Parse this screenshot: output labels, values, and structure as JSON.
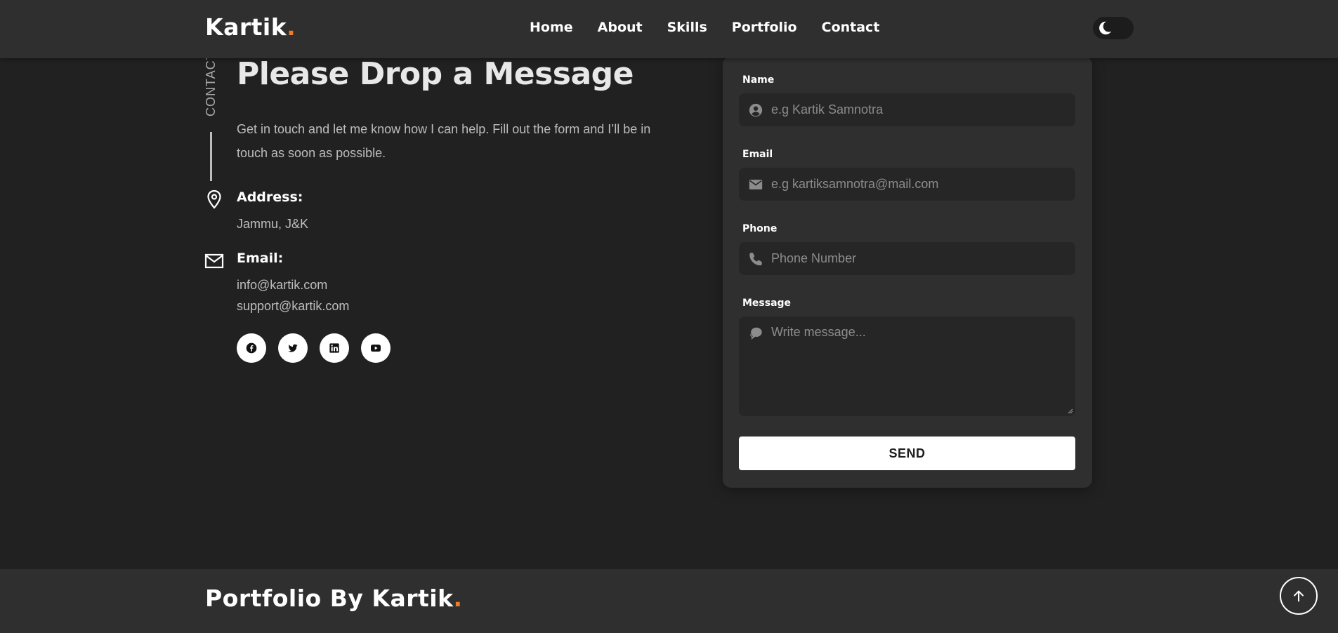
{
  "brand": {
    "name": "Kartik",
    "dot": ".",
    "accent": "#f07a2b"
  },
  "nav": {
    "items": [
      {
        "label": "Home"
      },
      {
        "label": "About"
      },
      {
        "label": "Skills"
      },
      {
        "label": "Portfolio"
      },
      {
        "label": "Contact"
      }
    ],
    "theme_toggle_icon": "moon-icon"
  },
  "contact": {
    "side_label": "CONTACT",
    "heading": "Please Drop a Message",
    "intro": "Get in touch and let me know how I can help. Fill out the form and I’ll be in touch as soon as possible.",
    "address": {
      "title": "Address:",
      "value": "Jammu, J&K",
      "icon": "location-pin-icon"
    },
    "email": {
      "title": "Email:",
      "values": [
        "info@kartik.com",
        "support@kartik.com"
      ],
      "icon": "envelope-icon"
    },
    "socials": [
      "facebook-icon",
      "twitter-icon",
      "linkedin-icon",
      "youtube-icon"
    ]
  },
  "form": {
    "name": {
      "label": "Name",
      "placeholder": "e.g Kartik Samnotra",
      "value": ""
    },
    "email": {
      "label": "Email",
      "placeholder": "e.g kartiksamnotra@mail.com",
      "value": ""
    },
    "phone": {
      "label": "Phone",
      "placeholder": "Phone Number",
      "value": ""
    },
    "message": {
      "label": "Message",
      "placeholder": "Write message...",
      "value": ""
    },
    "submit_label": "SEND"
  },
  "footer": {
    "brand_text": "Portfolio By Kartik",
    "dot": "."
  }
}
